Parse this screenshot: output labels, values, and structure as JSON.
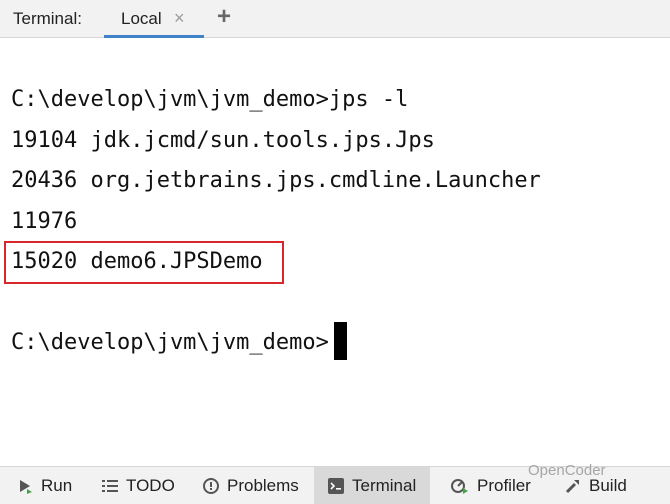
{
  "tabbar": {
    "caption": "Terminal:",
    "tab_label": "Local",
    "close_glyph": "×",
    "add_glyph": "+"
  },
  "terminal": {
    "lines": [
      "C:\\develop\\jvm\\jvm_demo>jps -l",
      "19104 jdk.jcmd/sun.tools.jps.Jps",
      "20436 org.jetbrains.jps.cmdline.Launcher",
      "11976",
      "15020 demo6.JPSDemo",
      "",
      "C:\\develop\\jvm\\jvm_demo>"
    ],
    "highlight_color": "#d9262c"
  },
  "bottombar": {
    "tools": [
      {
        "label": "Run",
        "icon": "run-icon"
      },
      {
        "label": "TODO",
        "icon": "list-icon"
      },
      {
        "label": "Problems",
        "icon": "problems-icon"
      },
      {
        "label": "Terminal",
        "icon": "terminal-icon"
      },
      {
        "label": "Profiler",
        "icon": "profiler-icon"
      },
      {
        "label": "Build",
        "icon": "build-icon"
      }
    ]
  },
  "watermark": "OpenCoder",
  "colors": {
    "accent": "#4083c9",
    "active_tool_bg": "#d9d9d9"
  }
}
